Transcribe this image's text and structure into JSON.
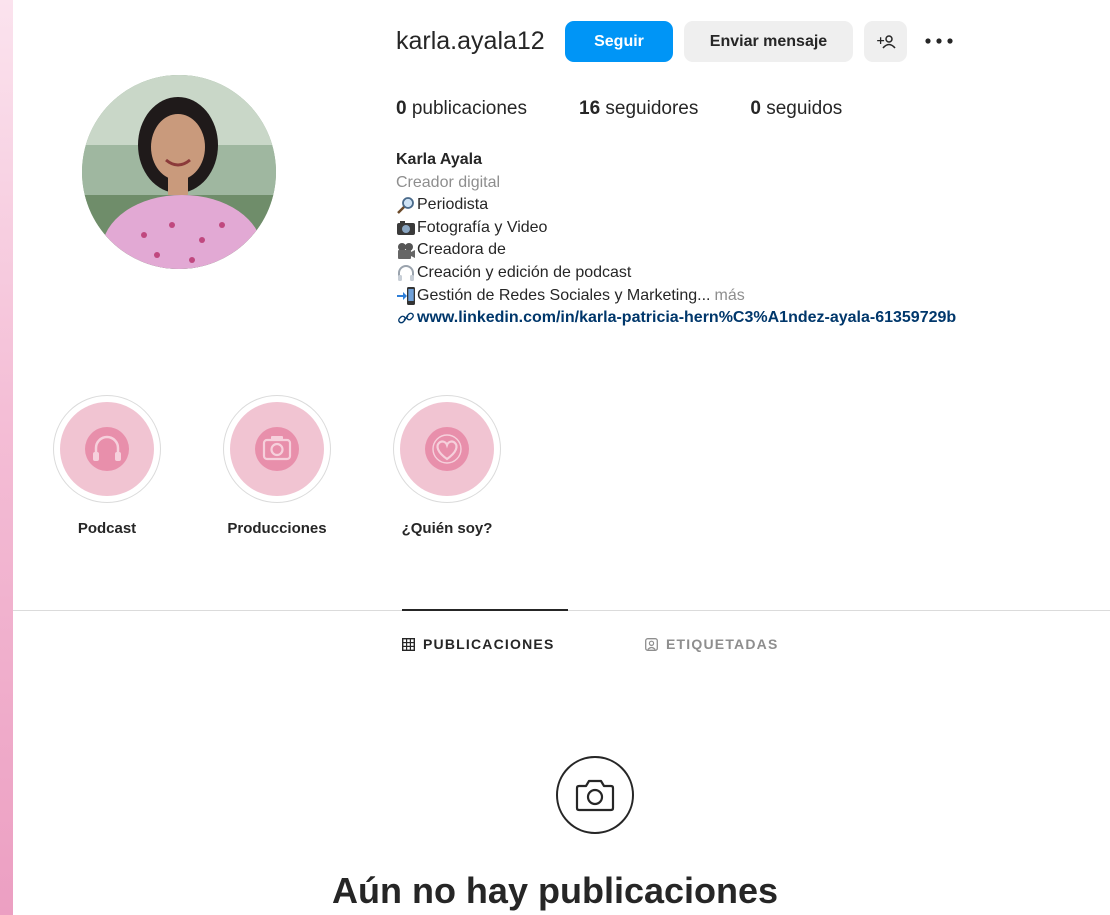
{
  "profile": {
    "username": "karla.ayala12",
    "follow_label": "Seguir",
    "message_label": "Enviar mensaje",
    "suggest_icon": "add-person-icon",
    "more_icon": "more-dots-icon"
  },
  "stats": [
    {
      "count": "0",
      "label": "publicaciones"
    },
    {
      "count": "16",
      "label": "seguidores"
    },
    {
      "count": "0",
      "label": "seguidos"
    }
  ],
  "bio": {
    "name": "Karla Ayala",
    "category": "Creador digital",
    "lines": [
      {
        "icon": "magnifier-icon",
        "text": "Periodista"
      },
      {
        "icon": "camera-icon",
        "text": "Fotografía y Video"
      },
      {
        "icon": "video-camera-icon",
        "text": "Creadora de"
      },
      {
        "icon": "headphones-icon",
        "text": " Creación y edición de podcast"
      },
      {
        "icon": "phone-arrow-icon",
        "text": " Gestión de Redes Sociales y Marketing..."
      }
    ],
    "more_label": "más",
    "link": "www.linkedin.com/in/karla-patricia-hern%C3%A1ndez-ayala-61359729b",
    "link_icon": "link-icon"
  },
  "highlights": [
    {
      "label": "Podcast",
      "icon": "headphones-icon"
    },
    {
      "label": "Producciones",
      "icon": "camera-icon"
    },
    {
      "label": "¿Quién soy?",
      "icon": "heart-icon"
    }
  ],
  "tabs": {
    "publicaciones": "PUBLICACIONES",
    "etiquetadas": "ETIQUETADAS"
  },
  "empty_state": {
    "icon": "camera-icon",
    "title": "Aún no hay publicaciones"
  },
  "colors": {
    "primary": "#0095f6",
    "link": "#00376b",
    "secondary_text": "#8e8e8e",
    "highlight_fill": "#f1c4d2"
  }
}
